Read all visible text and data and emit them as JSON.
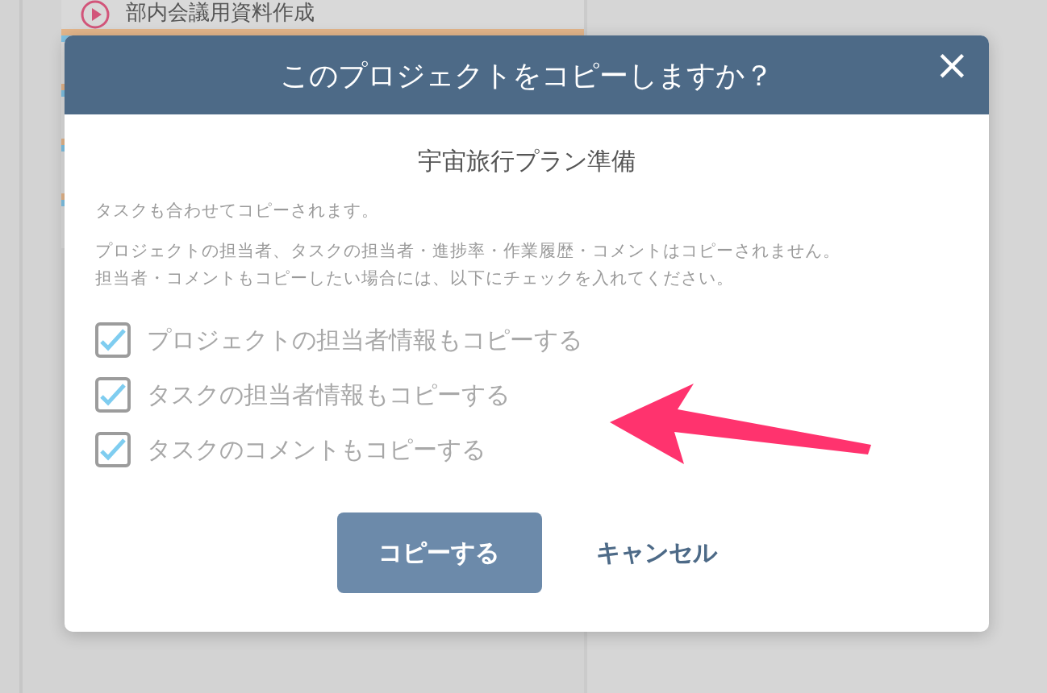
{
  "background": {
    "task_row": {
      "title": "部内会議用資料作成"
    }
  },
  "dialog": {
    "title": "このプロジェクトをコピーしますか？",
    "close": "×",
    "project_name": "宇宙旅行プラン準備",
    "note": "タスクも合わせてコピーされます。",
    "description": [
      "プロジェクトの担当者、タスクの担当者・進捗率・作業履歴・コメントはコピーされません。",
      "担当者・コメントもコピーしたい場合には、以下にチェックを入れてください。"
    ],
    "options": [
      {
        "label": "プロジェクトの担当者情報もコピーする",
        "checked": true
      },
      {
        "label": "タスクの担当者情報もコピーする",
        "checked": true
      },
      {
        "label": "タスクのコメントもコピーする",
        "checked": true
      }
    ],
    "buttons": [
      {
        "kind": "primary",
        "label": "コピーする"
      },
      {
        "kind": "link",
        "label": "キャンセル"
      }
    ]
  },
  "annotation": {
    "kind": "arrow"
  }
}
